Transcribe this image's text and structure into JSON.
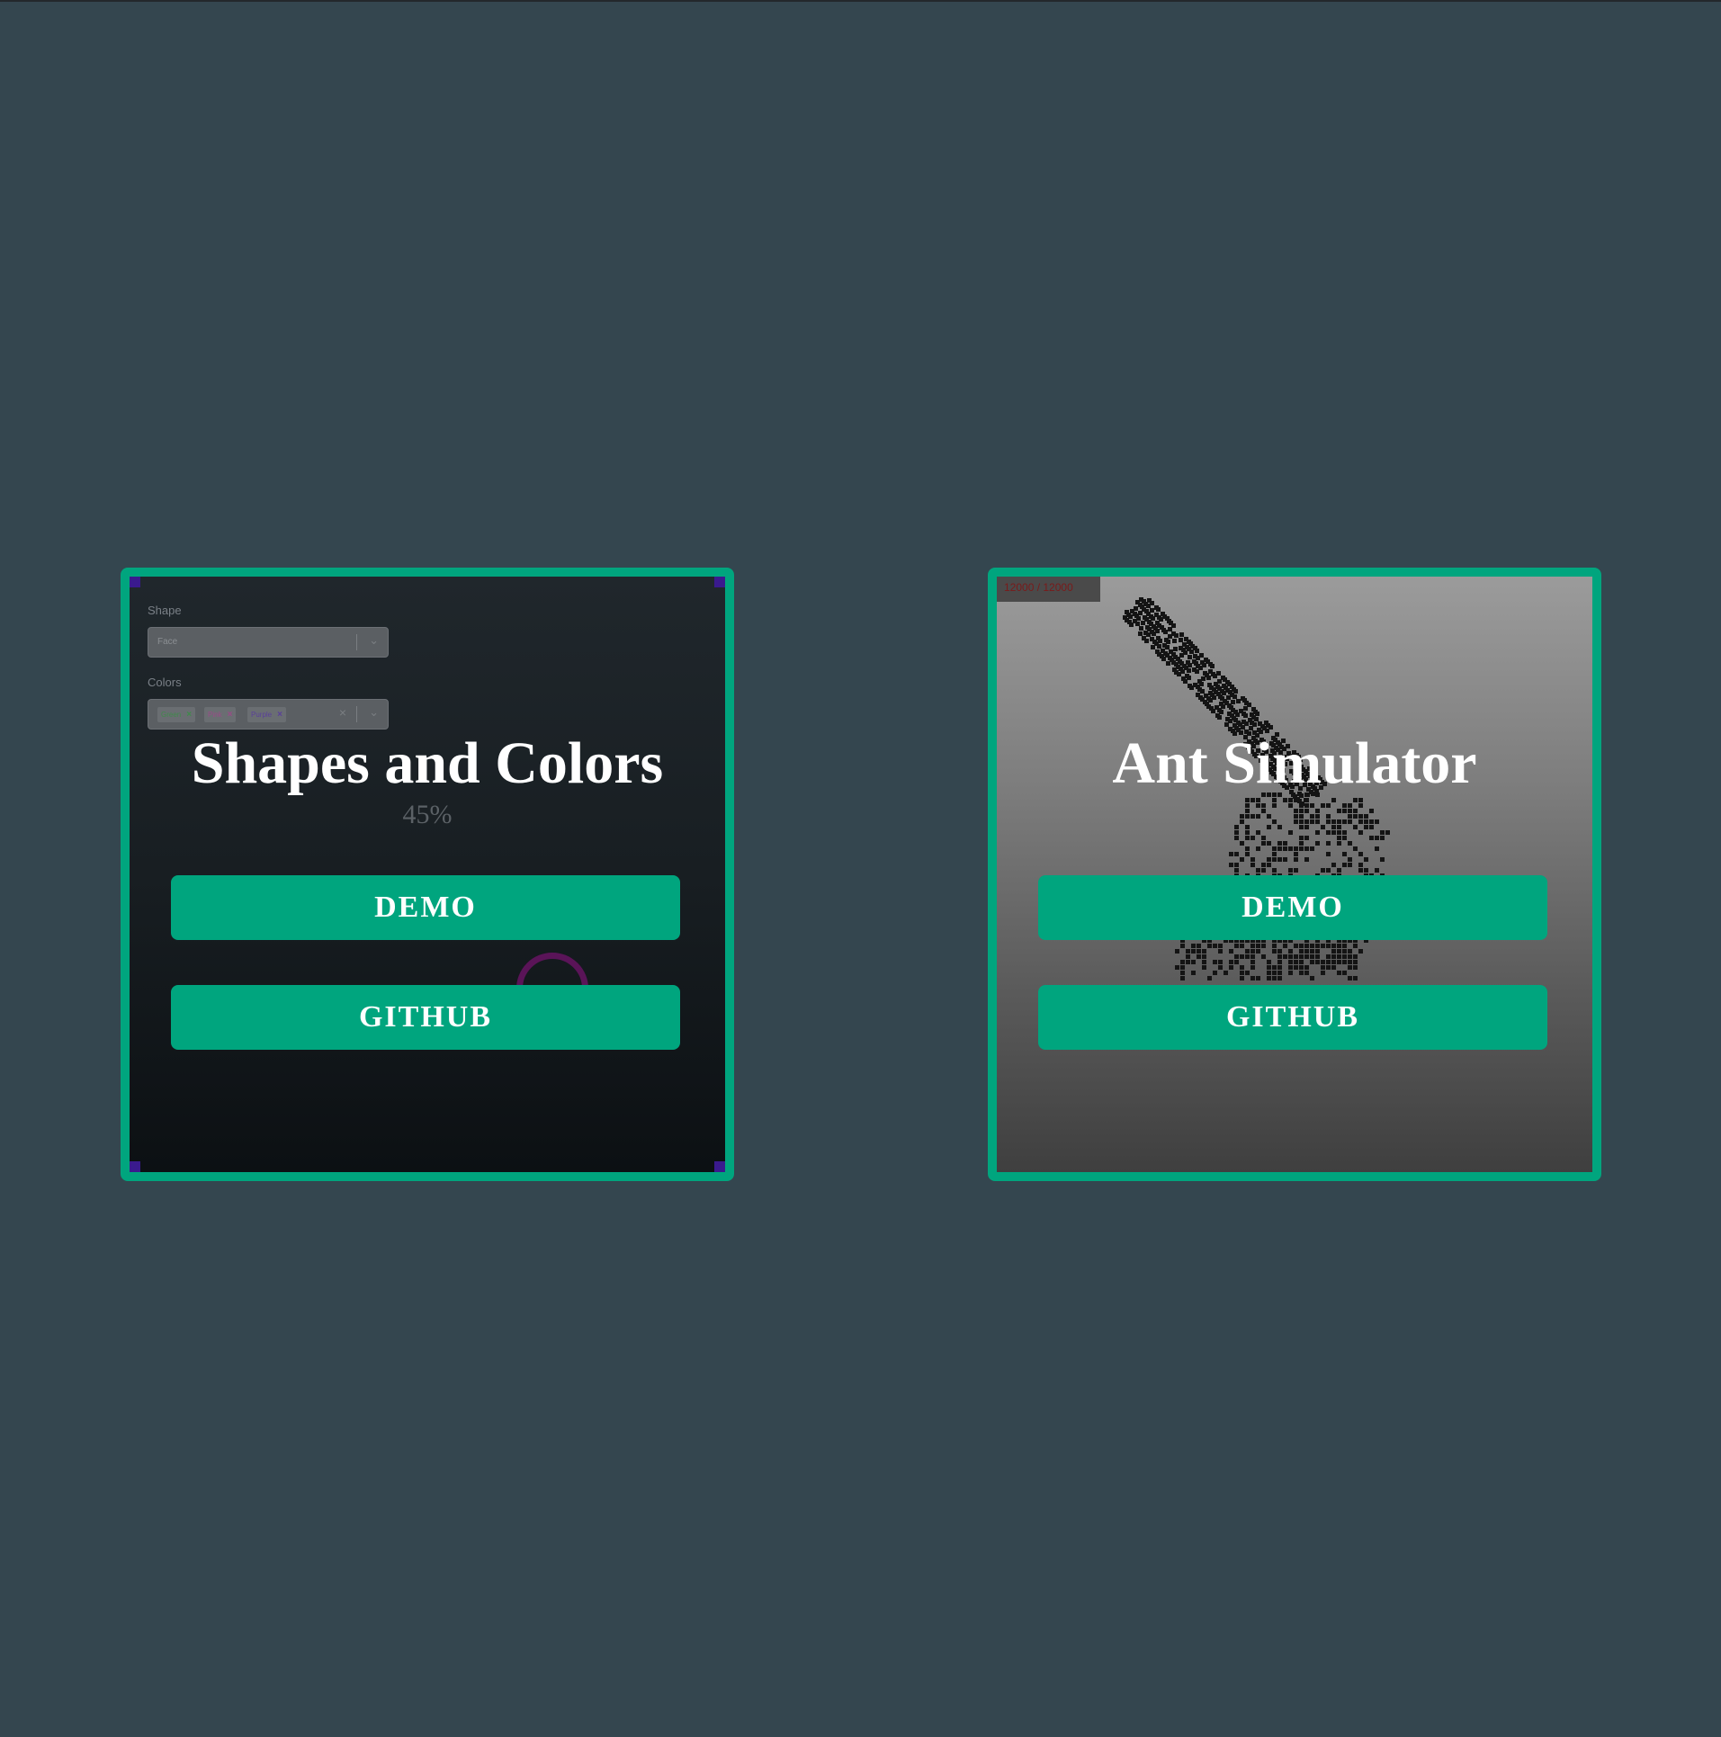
{
  "projects": [
    {
      "title": "Shapes and Colors",
      "demo_label": "DEMO",
      "github_label": "GITHUB",
      "preview": {
        "shape_label": "Shape",
        "shape_value": "Face",
        "colors_label": "Colors",
        "color_chips": [
          "Green",
          "Pink",
          "Purple"
        ],
        "percent": "45%"
      }
    },
    {
      "title": "Ant Simulator",
      "demo_label": "DEMO",
      "github_label": "GITHUB",
      "preview": {
        "counter": "12000 / 12000"
      }
    }
  ],
  "colors": {
    "page_background": "#34464f",
    "accent": "#00a57e",
    "button_text": "#ffffff"
  }
}
